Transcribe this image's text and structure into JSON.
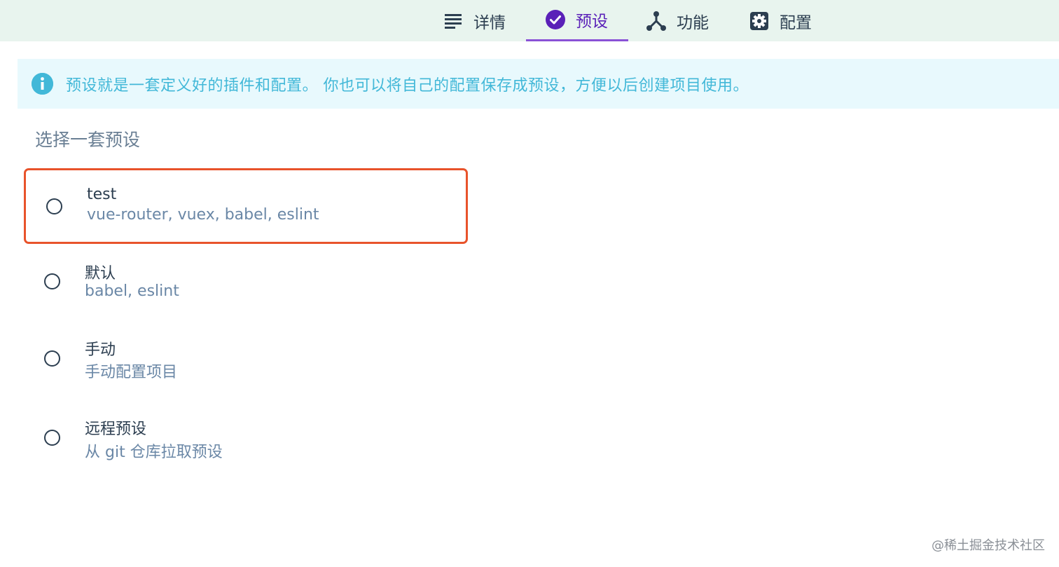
{
  "tabs": [
    {
      "label": "详情",
      "icon": "list-icon",
      "active": false
    },
    {
      "label": "预设",
      "icon": "check-circle-icon",
      "active": true
    },
    {
      "label": "功能",
      "icon": "fork-icon",
      "active": false
    },
    {
      "label": "配置",
      "icon": "gear-icon",
      "active": false
    }
  ],
  "info": {
    "icon": "info-icon",
    "text": "预设就是一套定义好的插件和配置。 你也可以将自己的配置保存成预设，方便以后创建项目使用。"
  },
  "section": {
    "title": "选择一套预设"
  },
  "presets": [
    {
      "name": "test",
      "description": "vue-router, vuex, babel, eslint",
      "highlighted": true
    },
    {
      "name": "默认",
      "description": "babel, eslint",
      "highlighted": false
    },
    {
      "name": "手动",
      "description": "手动配置项目",
      "highlighted": false
    },
    {
      "name": "远程预设",
      "description": "从 git 仓库拉取预设",
      "highlighted": false
    }
  ],
  "watermark": "@稀土掘金技术社区",
  "colors": {
    "tabbar_bg": "#e8f4ee",
    "active_tab": "#5a20b8",
    "info_bg": "#e8f9fd",
    "info_text": "#42b8d8",
    "highlight_border": "#e8532b",
    "text_primary": "#2c3e50",
    "text_secondary": "#6a87a6"
  }
}
